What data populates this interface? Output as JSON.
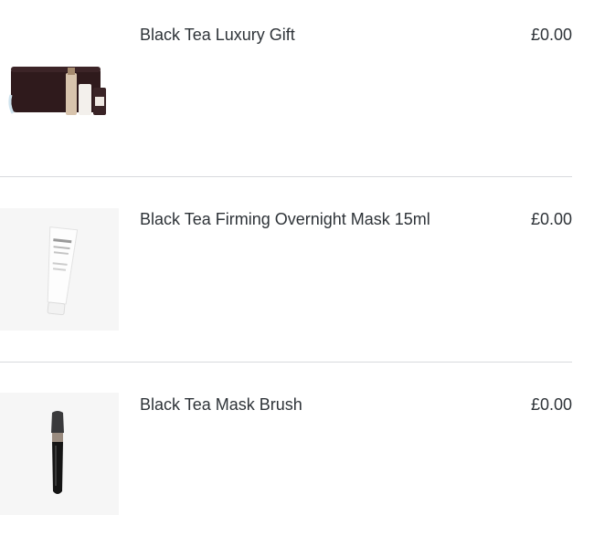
{
  "items": [
    {
      "name": "Black Tea Luxury Gift",
      "price": "£0.00",
      "image_icon": "gift-set-product-image"
    },
    {
      "name": "Black Tea Firming Overnight Mask 15ml",
      "price": "£0.00",
      "image_icon": "mask-tube-product-image"
    },
    {
      "name": "Black Tea Mask Brush",
      "price": "£0.00",
      "image_icon": "mask-brush-product-image"
    }
  ]
}
